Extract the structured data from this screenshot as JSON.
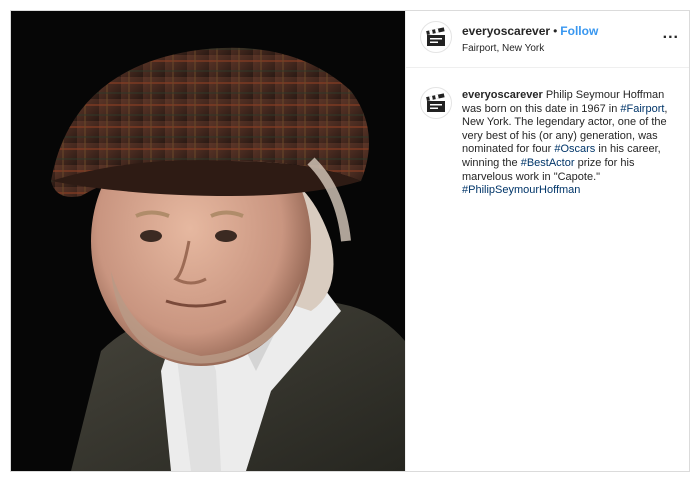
{
  "post": {
    "username": "everyoscarever",
    "follow_label": "Follow",
    "separator": "•",
    "location": "Fairport, New York",
    "more_label": "...",
    "avatar_icon": "clapperboard-icon",
    "photo": {
      "description_icon": "portrait-photo",
      "colors": {
        "background": "#060606",
        "cap": "#4a2a20",
        "cardigan": "#3b3a33",
        "shirt": "#eeeeee",
        "skin": "#d8a890"
      }
    },
    "caption": {
      "username": "everyoscarever",
      "t1": "Philip Seymour Hoffman was born on this date in 1967 in ",
      "tag1": "#Fairport",
      "t2": ", New York. The legendary actor, one of the very best of his (or any) generation, was nominated for four ",
      "tag2": "#Oscars",
      "t3": " in his career, winning the ",
      "tag3": "#BestActor",
      "t4": " prize for his marvelous work in \"Capote.\" ",
      "tag4": "#PhilipSeymourHoffman"
    },
    "colors": {
      "link": "#3897f0",
      "hashtag": "#003569",
      "text": "#262626",
      "border": "#dbdbdb"
    }
  }
}
